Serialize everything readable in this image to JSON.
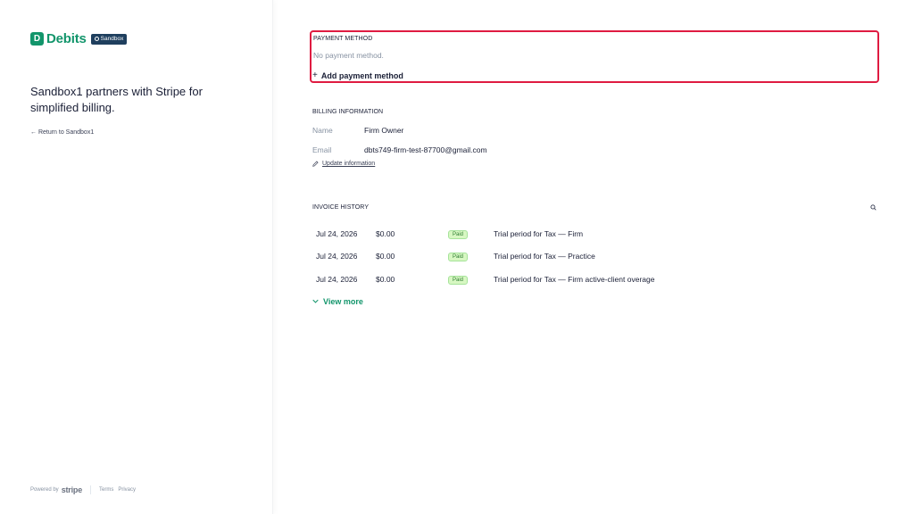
{
  "brand": {
    "name": "Debits",
    "badge": "Sandbox",
    "logo_glyph": "D",
    "color": "#12956b"
  },
  "left": {
    "tagline": "Sandbox1 partners with Stripe for simplified billing.",
    "return_link": "← Return to Sandbox1",
    "footer": {
      "powered_by": "Powered by",
      "stripe": "stripe",
      "terms": "Terms",
      "privacy": "Privacy"
    }
  },
  "payment_method": {
    "title": "PAYMENT METHOD",
    "empty_text": "No payment method.",
    "add_label": "Add payment method",
    "plus": "+",
    "border_color": "#df1b41"
  },
  "billing": {
    "title": "BILLING INFORMATION",
    "name_label": "Name",
    "name_value": "Firm Owner",
    "email_label": "Email",
    "email_value": "dbts749-firm-test-87700@gmail.com",
    "update_label": "Update information"
  },
  "invoices": {
    "title": "INVOICE HISTORY",
    "rows": [
      {
        "date": "Jul 24, 2026",
        "amount": "$0.00",
        "status": "Paid",
        "description": "Trial period for Tax — Firm"
      },
      {
        "date": "Jul 24, 2026",
        "amount": "$0.00",
        "status": "Paid",
        "description": "Trial period for Tax — Practice"
      },
      {
        "date": "Jul 24, 2026",
        "amount": "$0.00",
        "status": "Paid",
        "description": "Trial period for Tax — Firm active-client overage"
      }
    ],
    "view_more": "View more"
  },
  "icons": [
    "sandbox-icon",
    "pencil-icon",
    "search-icon",
    "chevron-down-icon",
    "plus-icon",
    "arrow-left-icon"
  ]
}
